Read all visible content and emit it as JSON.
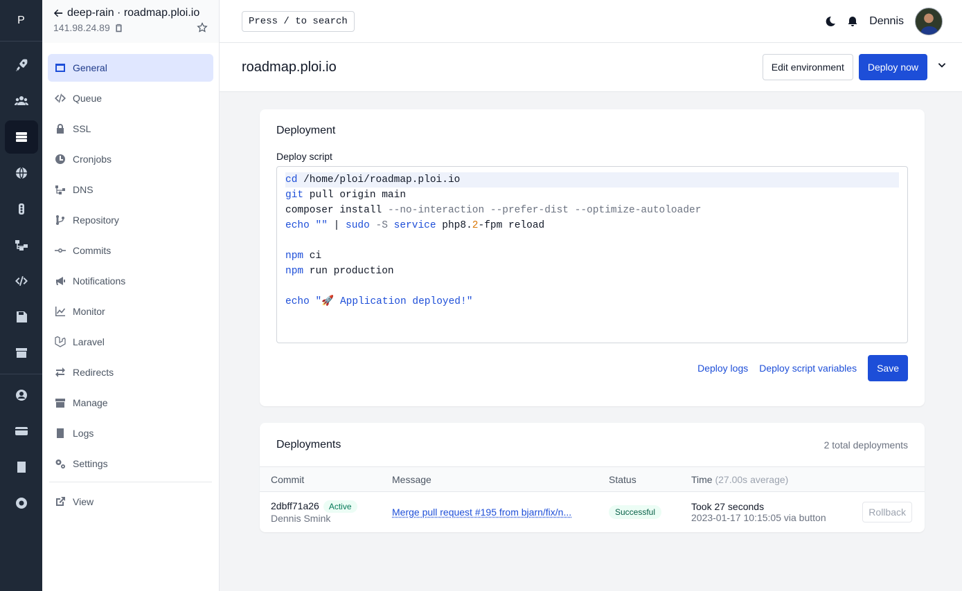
{
  "rail": {
    "logo": "P",
    "items": [
      "rocket-icon",
      "users-icon",
      "servers-icon",
      "globe-icon",
      "traffic-light-icon",
      "network-icon",
      "code-icon",
      "save-icon",
      "store-icon",
      "user-circle-icon",
      "credit-card-icon",
      "book-icon",
      "support-icon"
    ]
  },
  "server": {
    "name": "deep-rain · roadmap.ploi.io",
    "ip": "141.98.24.89"
  },
  "nav": {
    "items": [
      {
        "label": "General",
        "active": true
      },
      {
        "label": "Queue"
      },
      {
        "label": "SSL"
      },
      {
        "label": "Cronjobs"
      },
      {
        "label": "DNS"
      },
      {
        "label": "Repository"
      },
      {
        "label": "Commits"
      },
      {
        "label": "Notifications"
      },
      {
        "label": "Monitor"
      },
      {
        "label": "Laravel"
      },
      {
        "label": "Redirects"
      },
      {
        "label": "Manage"
      },
      {
        "label": "Logs"
      },
      {
        "label": "Settings"
      }
    ],
    "view": "View"
  },
  "topbar": {
    "search_hint": "Press / to search",
    "username": "Dennis"
  },
  "page": {
    "title": "roadmap.ploi.io",
    "edit_env": "Edit environment",
    "deploy_now": "Deploy now"
  },
  "deployment": {
    "title": "Deployment",
    "script_label": "Deploy script",
    "script_lines": [
      "cd /home/ploi/roadmap.ploi.io",
      "git pull origin main",
      "composer install --no-interaction --prefer-dist --optimize-autoloader",
      "echo \"\" | sudo -S service php8.2-fpm reload",
      "",
      "npm ci",
      "npm run production",
      "",
      "echo \"🚀 Application deployed!\""
    ],
    "deploy_logs": "Deploy logs",
    "script_variables": "Deploy script variables",
    "save": "Save"
  },
  "deployments": {
    "title": "Deployments",
    "total": "2 total deployments",
    "columns": {
      "commit": "Commit",
      "message": "Message",
      "status": "Status",
      "time": "Time",
      "time_avg": "(27.00s average)"
    },
    "rows": [
      {
        "commit": "2dbff71a26",
        "active_badge": "Active",
        "author": "Dennis Smink",
        "message": "Merge pull request #195 from bjarn/fix/n...",
        "status": "Successful",
        "took": "Took 27 seconds",
        "when": "2023-01-17 10:15:05 via button",
        "rollback": "Rollback"
      }
    ]
  }
}
